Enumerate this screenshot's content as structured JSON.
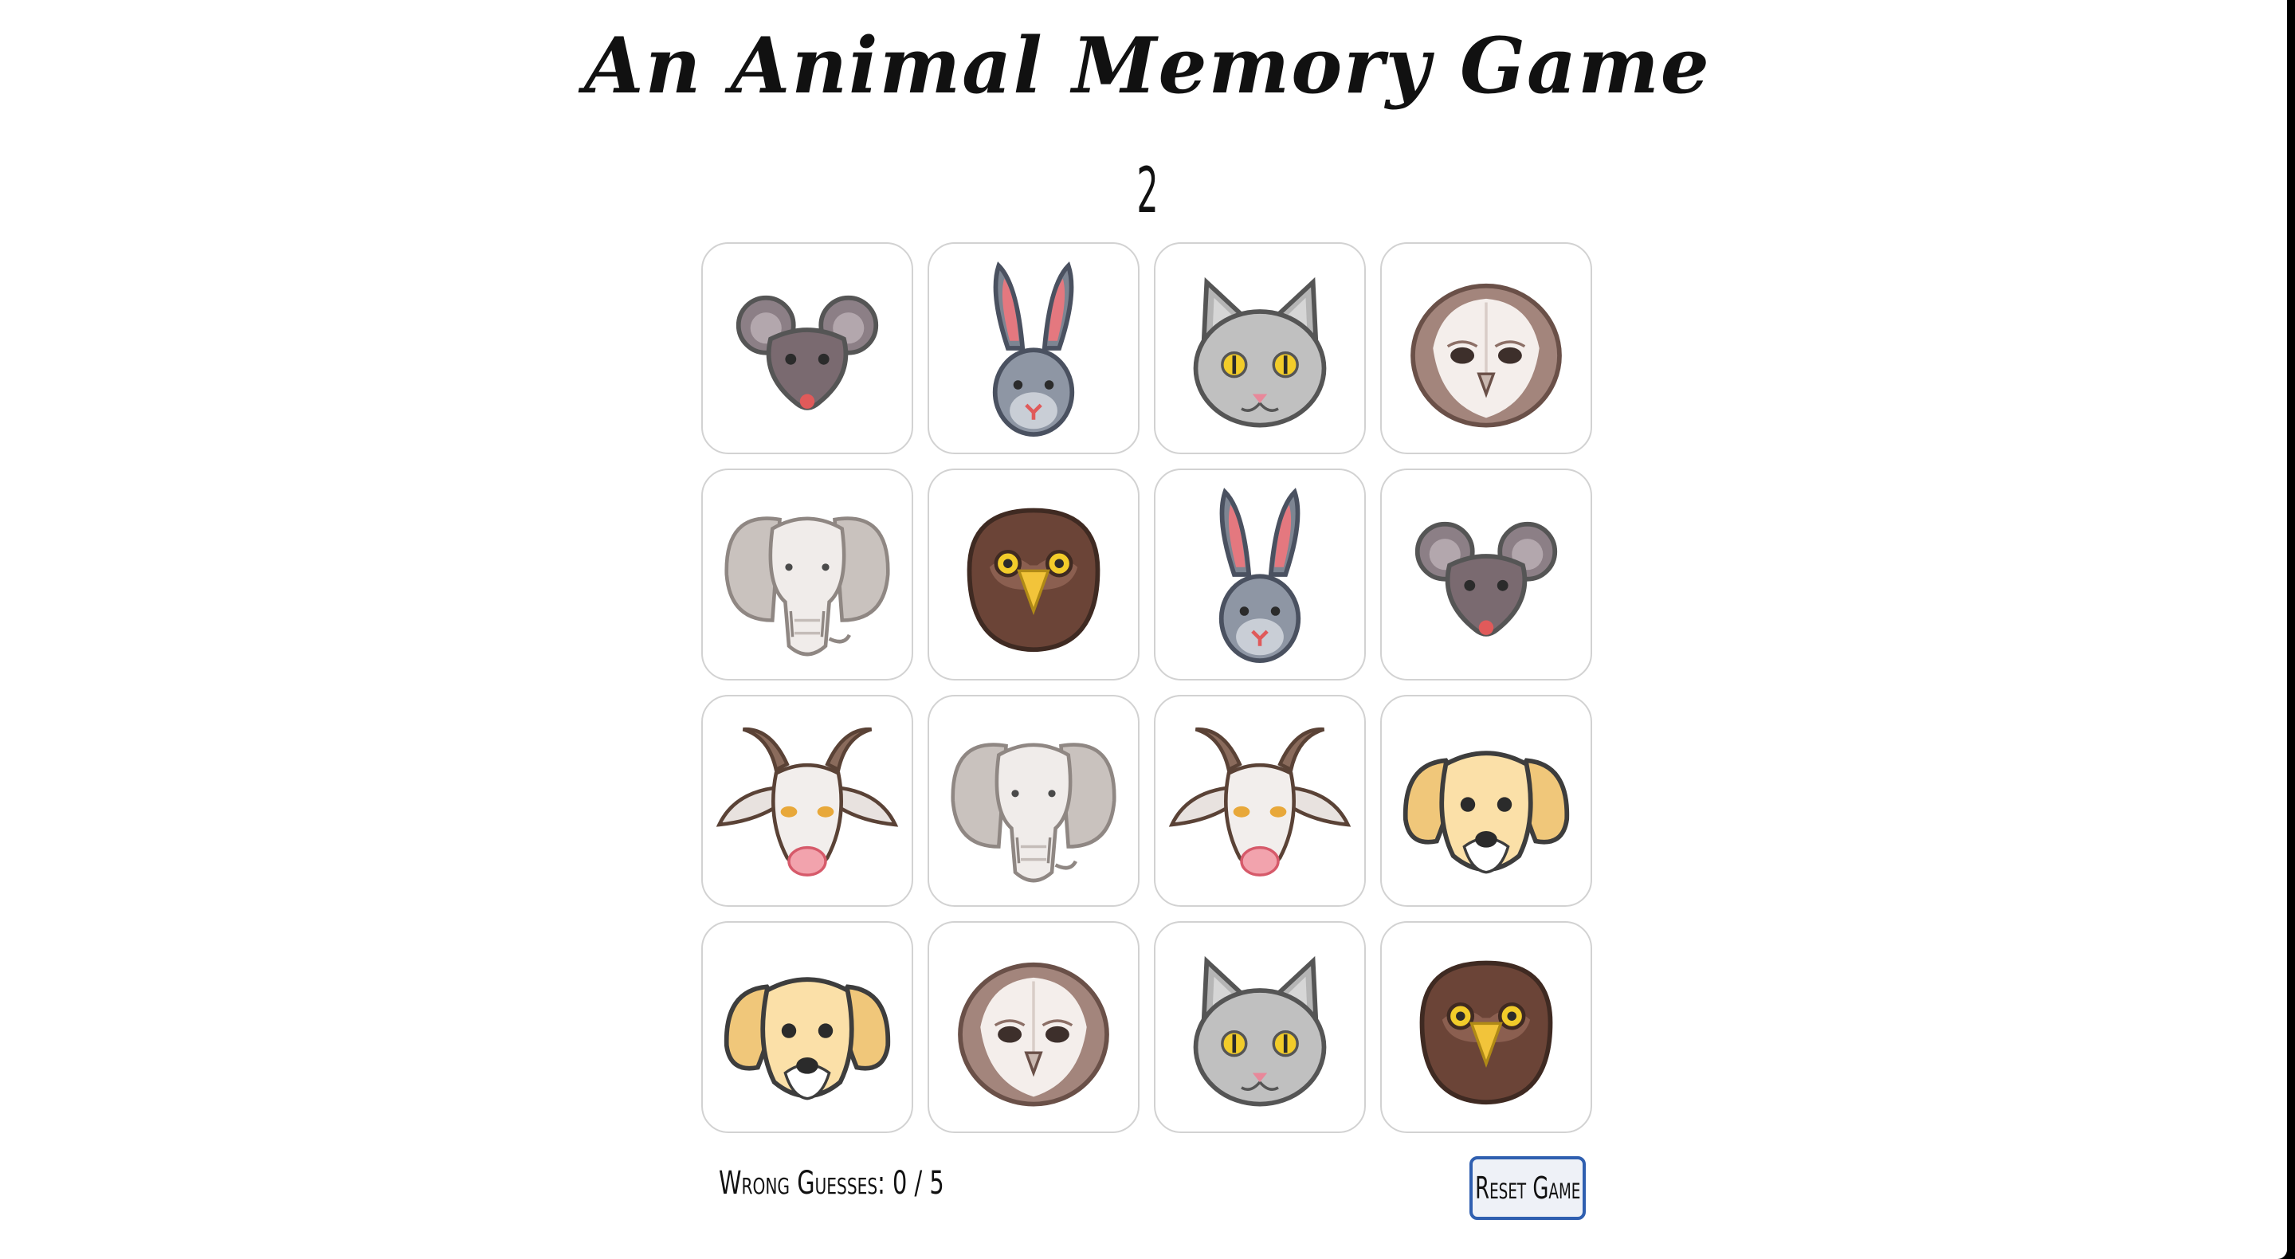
{
  "title": "An Animal Memory Game",
  "timer": "2",
  "cards": [
    {
      "animal": "mouse"
    },
    {
      "animal": "rabbit"
    },
    {
      "animal": "cat"
    },
    {
      "animal": "barn-owl"
    },
    {
      "animal": "elephant"
    },
    {
      "animal": "hawk"
    },
    {
      "animal": "rabbit"
    },
    {
      "animal": "mouse"
    },
    {
      "animal": "goat"
    },
    {
      "animal": "elephant"
    },
    {
      "animal": "goat"
    },
    {
      "animal": "dog"
    },
    {
      "animal": "dog"
    },
    {
      "animal": "barn-owl"
    },
    {
      "animal": "cat"
    },
    {
      "animal": "hawk"
    }
  ],
  "footer": {
    "wrong_guesses": "Wrong Guesses: 0 / 5",
    "reset_label": "Reset Game"
  },
  "colors": {
    "card_border": "#d2d2d2",
    "reset_border": "#2f5fb0",
    "text": "#111111"
  }
}
